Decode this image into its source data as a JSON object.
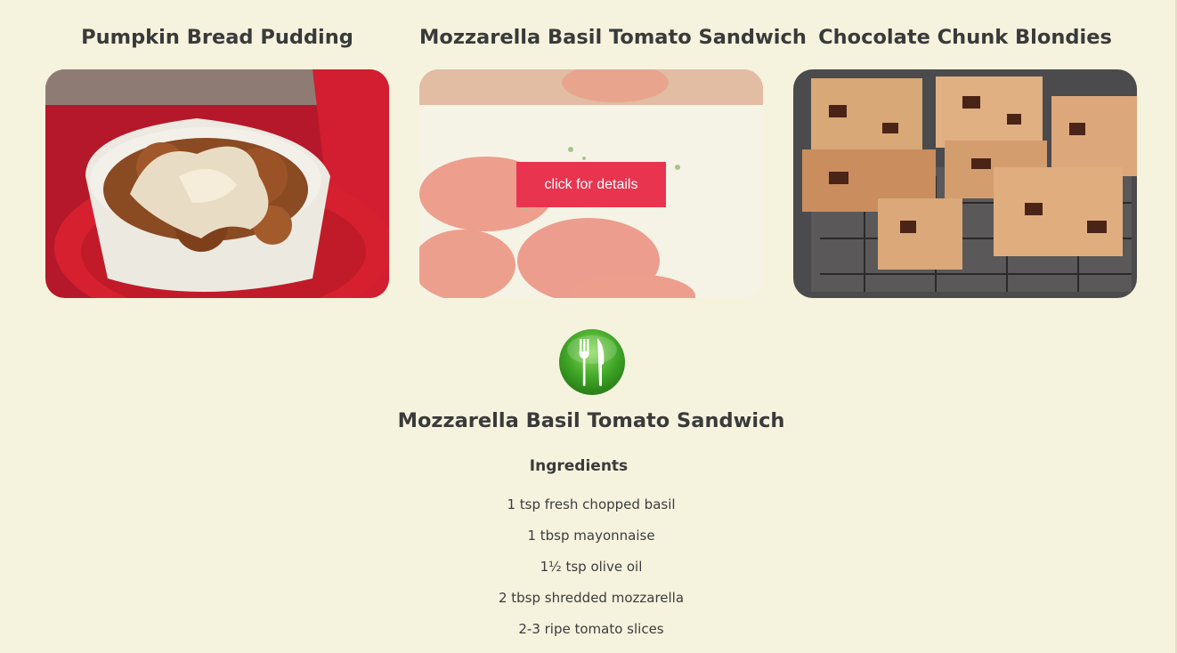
{
  "recipes": [
    {
      "title": "Pumpkin Bread Pudding",
      "image": "pumpkin-bread-pudding-photo"
    },
    {
      "title": "Mozzarella Basil Tomato Sandwich",
      "image": "tomato-slices-photo",
      "button_label": "click for details"
    },
    {
      "title": "Chocolate Chunk Blondies",
      "image": "chocolate-chunk-blondies-photo"
    }
  ],
  "detail": {
    "icon": "fork-knife-icon",
    "title": "Mozzarella Basil Tomato Sandwich",
    "ingredients_heading": "Ingredients",
    "ingredients": [
      "1 tsp fresh chopped basil",
      "1 tbsp mayonnaise",
      "1½ tsp olive oil",
      "2 tbsp shredded mozzarella",
      "2-3 ripe tomato slices"
    ]
  },
  "colors": {
    "background": "#f5f3de",
    "button": "#e8344f",
    "icon_green": "#3fa627",
    "text": "#3a3a3a"
  }
}
